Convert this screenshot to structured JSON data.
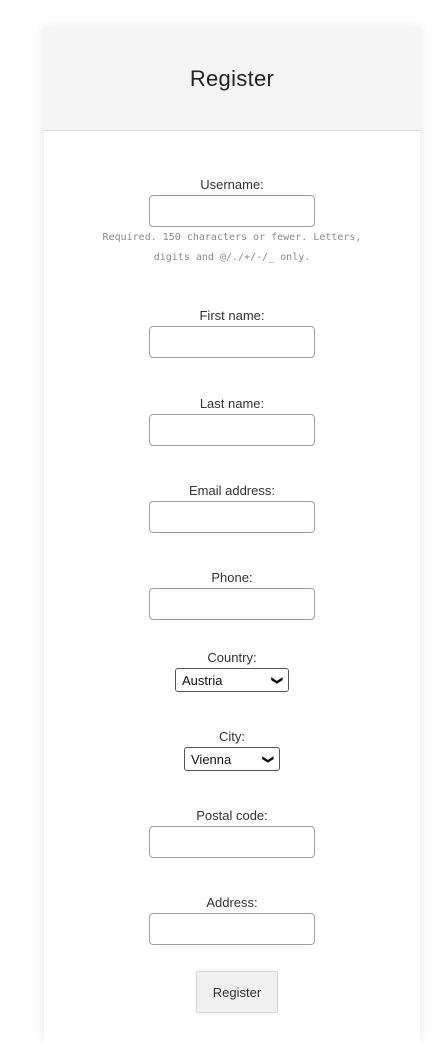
{
  "card": {
    "title": "Register"
  },
  "form": {
    "username": {
      "label": "Username:",
      "help_line1": "Required. 150 characters or fewer. Letters,",
      "help_line2": "digits and @/./+/-/_ only."
    },
    "first_name": {
      "label": "First name:"
    },
    "last_name": {
      "label": "Last name:"
    },
    "email": {
      "label": "Email address:"
    },
    "phone": {
      "label": "Phone:"
    },
    "country": {
      "label": "Country:",
      "selected": "Austria",
      "icon": "chevron-down-icon"
    },
    "city": {
      "label": "City:",
      "selected": "Vienna",
      "icon": "chevron-down-icon"
    },
    "postal_code": {
      "label": "Postal code:"
    },
    "address": {
      "label": "Address:"
    },
    "submit_label": "Register"
  }
}
